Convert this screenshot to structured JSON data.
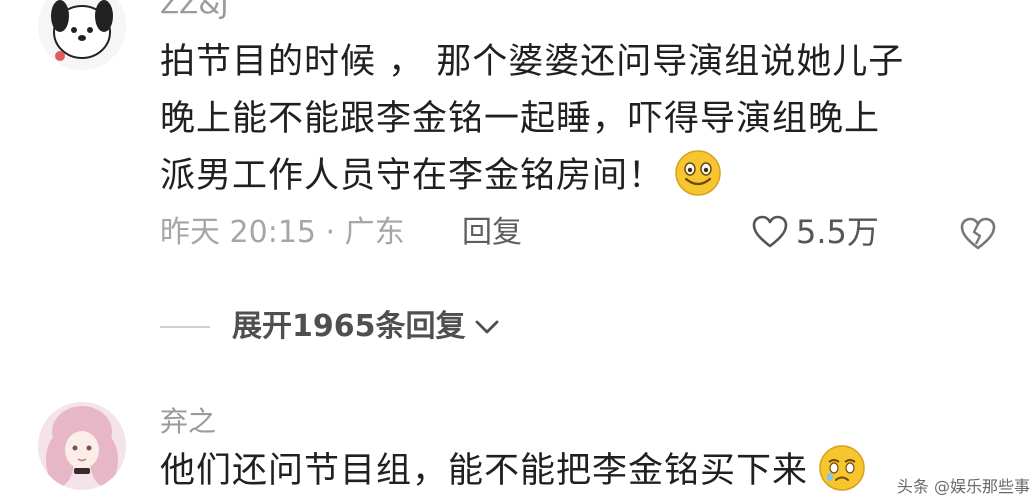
{
  "comments": [
    {
      "username": "ZZ&J",
      "lines": [
        "拍节目的时候 ， 那个婆婆还问导演组说她儿子",
        "晚上能不能跟李金铭一起睡，吓得导演组晚上",
        "派男工作人员守在李金铭房间！"
      ],
      "emoji": "grin-emoji",
      "time_location": "昨天 20:15 · 广东",
      "reply_label": "回复",
      "like_count": "5.5万",
      "expand_label": "展开1965条回复"
    },
    {
      "username": "弃之",
      "lines": [
        "他们还问节目组，能不能把李金铭买下来"
      ],
      "emoji": "crying-emoji"
    }
  ],
  "icons": {
    "like": "heart-outline-icon",
    "dislike": "broken-heart-icon",
    "expand": "chevron-down-icon"
  },
  "watermark": "头条 @娱乐那些事",
  "colors": {
    "text": "#202020",
    "meta": "#a6a6a6",
    "username": "#9b9b9b",
    "emoji_face": "#f7c52e"
  }
}
